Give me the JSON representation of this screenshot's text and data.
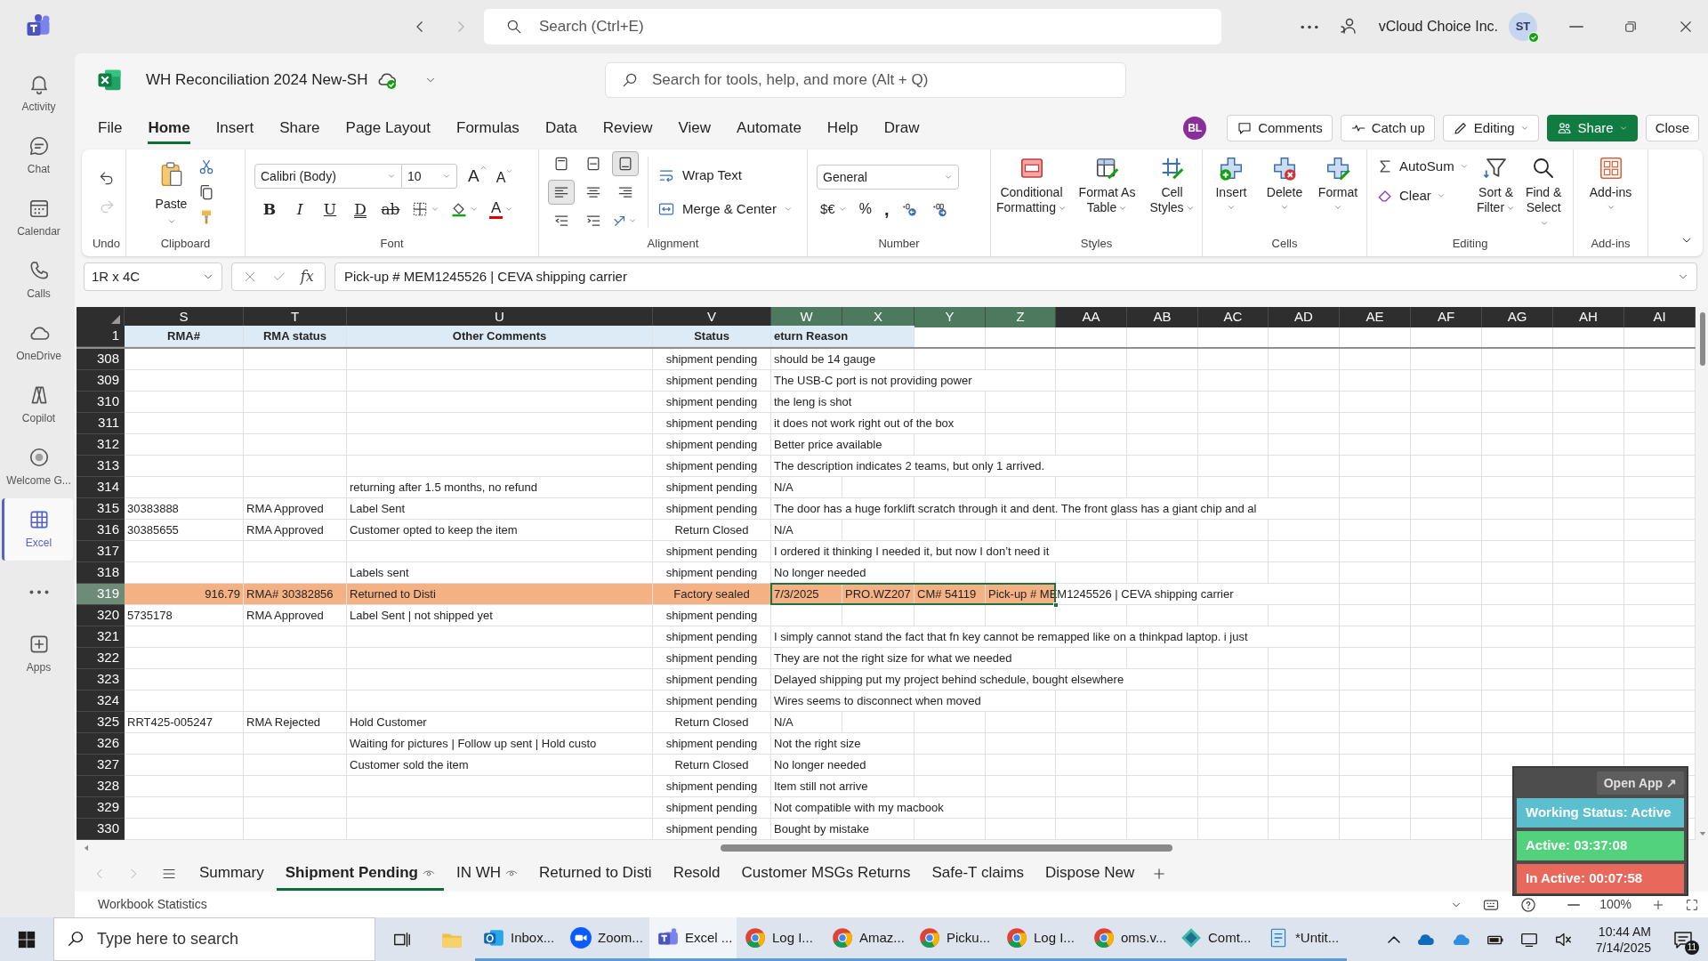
{
  "teams": {
    "search_placeholder": "Search (Ctrl+E)",
    "org": "vCloud Choice Inc.",
    "avatar": "ST",
    "rail": [
      {
        "kind": "activity",
        "label": "Activity",
        "selected": false
      },
      {
        "kind": "chat",
        "label": "Chat",
        "selected": false
      },
      {
        "kind": "calendar",
        "label": "Calendar",
        "selected": false
      },
      {
        "kind": "calls",
        "label": "Calls",
        "selected": false
      },
      {
        "kind": "onedrive",
        "label": "OneDrive",
        "selected": false
      },
      {
        "kind": "copilot",
        "label": "Copilot",
        "selected": false
      },
      {
        "kind": "welcome",
        "label": "Welcome G...",
        "selected": false
      },
      {
        "kind": "excel",
        "label": "Excel",
        "selected": true
      },
      {
        "kind": "more",
        "selected": false
      },
      {
        "kind": "apps",
        "label": "Apps",
        "selected": false
      }
    ]
  },
  "workbook": {
    "title": "WH Reconciliation 2024 New-SH",
    "search_placeholder": "Search for tools, help, and more (Alt + Q)"
  },
  "menu": [
    {
      "label": "File",
      "selected": false
    },
    {
      "label": "Home",
      "selected": true
    },
    {
      "label": "Insert",
      "selected": false
    },
    {
      "label": "Share",
      "selected": false
    },
    {
      "label": "Page Layout",
      "selected": false
    },
    {
      "label": "Formulas",
      "selected": false
    },
    {
      "label": "Data",
      "selected": false
    },
    {
      "label": "Review",
      "selected": false
    },
    {
      "label": "View",
      "selected": false
    },
    {
      "label": "Automate",
      "selected": false
    },
    {
      "label": "Help",
      "selected": false
    },
    {
      "label": "Draw",
      "selected": false
    }
  ],
  "collab": {
    "avatar": "BL",
    "buttons": [
      {
        "kind": "comments",
        "label": "Comments"
      },
      {
        "kind": "catchup",
        "label": "Catch up"
      },
      {
        "kind": "editing",
        "label": "Editing"
      },
      {
        "kind": "share",
        "label": "Share"
      },
      {
        "kind": "close",
        "label": "Close"
      }
    ]
  },
  "ribbon": [
    {
      "kind": "undo",
      "label": "Undo"
    },
    {
      "kind": "clipboard",
      "label": "Clipboard",
      "paste": "Paste"
    },
    {
      "kind": "font",
      "label": "Font",
      "font": "Calibri (Body)",
      "size": "10",
      "grow": "A",
      "shrink": "A",
      "styles": [
        "B",
        "I",
        "U",
        "D",
        "ab"
      ],
      "font_color_label": "A"
    },
    {
      "kind": "alignment",
      "label": "Alignment",
      "wrap": "Wrap Text",
      "merge": "Merge & Center",
      "buttons": [
        {
          "kind": "top",
          "selected": false
        },
        {
          "kind": "middle",
          "selected": false
        },
        {
          "kind": "bottom",
          "selected": true
        },
        {
          "kind": "left",
          "selected": true
        },
        {
          "kind": "center",
          "selected": false
        },
        {
          "kind": "right",
          "selected": false
        }
      ]
    },
    {
      "kind": "number",
      "label": "Number",
      "format": "General",
      "currency": "$€",
      "percent": "%",
      "comma": ","
    },
    {
      "kind": "styles",
      "label": "Styles",
      "buttons": [
        "Conditional Formatting",
        "Format As Table",
        "Cell Styles"
      ]
    },
    {
      "kind": "cells",
      "label": "Cells",
      "buttons": [
        "Insert",
        "Delete",
        "Format"
      ]
    },
    {
      "kind": "editing",
      "label": "Editing",
      "buttons": [
        "AutoSum",
        "Clear",
        "Sort & Filter",
        "Find & Select"
      ]
    },
    {
      "kind": "addins",
      "label": "Add-ins",
      "buttons": [
        "Add-ins"
      ]
    }
  ],
  "formula_bar": {
    "name_box": "1R x 4C",
    "function_label": "fx",
    "formula": "Pick-up # MEM1245526 | CEVA shipping carrier"
  },
  "columns": [
    {
      "label": "S",
      "selected": false
    },
    {
      "label": "T",
      "selected": false
    },
    {
      "label": "U",
      "selected": false
    },
    {
      "label": "V",
      "selected": false
    },
    {
      "label": "W",
      "selected": true
    },
    {
      "label": "X",
      "selected": true
    },
    {
      "label": "Y",
      "selected": true
    },
    {
      "label": "Z",
      "selected": true
    },
    {
      "label": "AA",
      "selected": false
    },
    {
      "label": "AB",
      "selected": false
    },
    {
      "label": "AC",
      "selected": false
    },
    {
      "label": "AD",
      "selected": false
    },
    {
      "label": "AE",
      "selected": false
    },
    {
      "label": "AF",
      "selected": false
    },
    {
      "label": "AG",
      "selected": false
    },
    {
      "label": "AH",
      "selected": false
    },
    {
      "label": "AI",
      "selected": false
    }
  ],
  "header_row": {
    "number": "1",
    "labels": [
      "RMA#",
      "RMA status",
      "Other Comments",
      "Status",
      "eturn Reason"
    ]
  },
  "rows": [
    {
      "number": "308",
      "status": "shipment pending",
      "reason": "should be 14 gauge",
      "highlighted": false,
      "selected": false
    },
    {
      "number": "309",
      "status": "shipment pending",
      "reason": "The USB-C port is not providing power",
      "highlighted": false,
      "selected": false
    },
    {
      "number": "310",
      "status": "shipment pending",
      "reason": "the leng is shot",
      "highlighted": false,
      "selected": false
    },
    {
      "number": "311",
      "status": "shipment pending",
      "reason": "it does not work right out of the box",
      "highlighted": false,
      "selected": false
    },
    {
      "number": "312",
      "status": "shipment pending",
      "reason": "Better price available",
      "highlighted": false,
      "selected": false
    },
    {
      "number": "313",
      "status": "shipment pending",
      "reason": "The description indicates 2 teams, but only 1 arrived.",
      "highlighted": false,
      "selected": false
    },
    {
      "number": "314",
      "comments": "returning after 1.5 months, no refund",
      "status": "shipment pending",
      "reason": "N/A",
      "highlighted": false,
      "selected": false
    },
    {
      "number": "315",
      "rma": "30383888",
      "rma_status": "RMA Approved",
      "comments": "Label Sent",
      "status": "shipment pending",
      "reason": "The door has a huge forklift scratch through it and dent. The front glass has a giant chip and al",
      "highlighted": false,
      "selected": false
    },
    {
      "number": "316",
      "rma": "30385655",
      "rma_status": "RMA Approved",
      "comments": "Customer opted to keep the item",
      "status": "Return Closed",
      "reason": "N/A",
      "highlighted": false,
      "selected": false
    },
    {
      "number": "317",
      "status": "shipment pending",
      "reason": "I ordered it thinking I needed it, but now I don’t need it",
      "highlighted": false,
      "selected": false
    },
    {
      "number": "318",
      "comments": "Labels sent",
      "status": "shipment pending",
      "reason": "No longer needed",
      "highlighted": false,
      "selected": false
    },
    {
      "number": "319",
      "rma": "916.79",
      "rma_status": "RMA# 30382856",
      "comments": "Returned to Disti",
      "status": "Factory sealed",
      "reason": "7/3/2025",
      "x": "PRO.WZ207",
      "y": "CM# 54119",
      "z": "Pick-up # MEM1245526 | CEVA shipping carrier",
      "highlighted": true,
      "selected": true
    },
    {
      "number": "320",
      "rma": "5735178",
      "rma_status": "RMA Approved",
      "comments": "Label Sent | not shipped yet",
      "status": "shipment pending",
      "highlighted": false,
      "selected": false
    },
    {
      "number": "321",
      "status": "shipment pending",
      "reason": "I simply cannot stand the fact that fn key cannot be remapped like on a thinkpad laptop. i just",
      "highlighted": false,
      "selected": false
    },
    {
      "number": "322",
      "status": "shipment pending",
      "reason": "They are not the right size for what we needed",
      "highlighted": false,
      "selected": false
    },
    {
      "number": "323",
      "status": "shipment pending",
      "reason": "Delayed shipping put my project behind schedule, bought elsewhere",
      "highlighted": false,
      "selected": false
    },
    {
      "number": "324",
      "status": "shipment pending",
      "reason": "Wires seems to disconnect when moved",
      "highlighted": false,
      "selected": false
    },
    {
      "number": "325",
      "rma": "RRT425-005247",
      "rma_status": "RMA Rejected",
      "comments": "Hold Customer",
      "status": "Return Closed",
      "reason": "N/A",
      "highlighted": false,
      "selected": false
    },
    {
      "number": "326",
      "comments": "Waiting for pictures | Follow up sent | Hold custo",
      "status": "shipment pending",
      "reason": "Not the right size",
      "highlighted": false,
      "selected": false
    },
    {
      "number": "327",
      "comments": "Customer sold the item",
      "status": "Return Closed",
      "reason": "No longer needed",
      "highlighted": false,
      "selected": false
    },
    {
      "number": "328",
      "status": "shipment pending",
      "reason": "Item still not arrive",
      "highlighted": false,
      "selected": false
    },
    {
      "number": "329",
      "status": "shipment pending",
      "reason": "Not compatible with my macbook",
      "highlighted": false,
      "selected": false
    },
    {
      "number": "330",
      "status": "shipment pending",
      "reason": "Bought by mistake",
      "highlighted": false,
      "selected": false
    }
  ],
  "sheet_tabs": [
    {
      "label": "Summary",
      "selected": false,
      "watched": false
    },
    {
      "label": "Shipment Pending",
      "selected": true,
      "watched": true
    },
    {
      "label": "IN WH",
      "selected": false,
      "watched": true
    },
    {
      "label": "Returned to Disti",
      "selected": false,
      "watched": false
    },
    {
      "label": "Resold",
      "selected": false,
      "watched": false
    },
    {
      "label": "Customer MSGs Returns",
      "selected": false,
      "watched": false
    },
    {
      "label": "Safe-T claims",
      "selected": false,
      "watched": false
    },
    {
      "label": "Dispose New",
      "selected": false,
      "watched": false
    }
  ],
  "status_bar": {
    "label": "Workbook Statistics",
    "zoom": "100%"
  },
  "widget": {
    "open_app": "Open App ↗",
    "items": [
      {
        "text": "Working Status: Active",
        "color": "#5bbfd0"
      },
      {
        "text": "Active: 03:37:08",
        "color": "#52d27c"
      },
      {
        "text": "In Active: 00:07:58",
        "color": "#e8695c"
      }
    ]
  },
  "taskbar": {
    "search_placeholder": "Type here to search",
    "apps": [
      {
        "kind": "explorer",
        "selected": false
      },
      {
        "kind": "outlook",
        "label": "Inbox...",
        "selected": false
      },
      {
        "kind": "zoom",
        "label": "Zoom...",
        "selected": false
      },
      {
        "kind": "teams",
        "label": "Excel ...",
        "selected": true
      },
      {
        "kind": "chrome",
        "label": "Log I...",
        "selected": false
      },
      {
        "kind": "chrome",
        "label": "Amaz...",
        "selected": false
      },
      {
        "kind": "chrome",
        "label": "Picku...",
        "selected": false
      },
      {
        "kind": "chrome",
        "label": "Log I...",
        "selected": false
      },
      {
        "kind": "chrome",
        "label": "oms.v...",
        "selected": false
      },
      {
        "kind": "comet",
        "label": "Comt...",
        "selected": false
      },
      {
        "kind": "notepad",
        "label": "*Untit...",
        "selected": false
      }
    ],
    "time": "10:44 AM",
    "date": "7/14/2025",
    "notifications": "11"
  }
}
